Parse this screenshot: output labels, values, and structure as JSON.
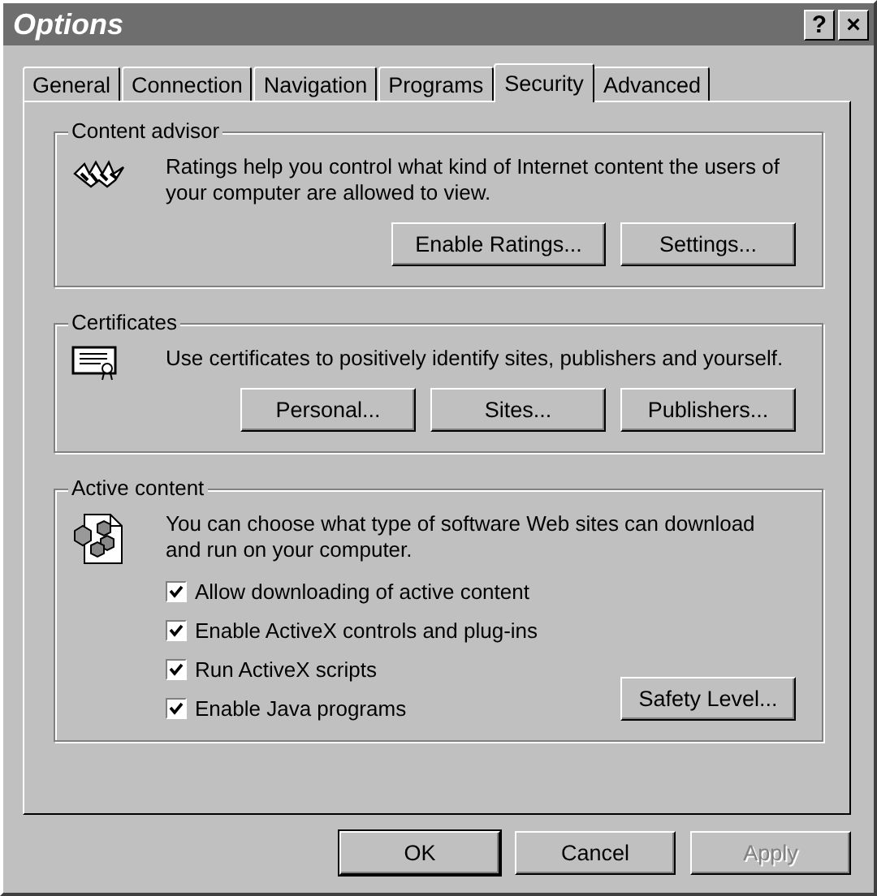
{
  "window": {
    "title": "Options",
    "title_buttons": [
      "?",
      "×"
    ]
  },
  "tabs": [
    {
      "label": "General",
      "selected": false
    },
    {
      "label": "Connection",
      "selected": false
    },
    {
      "label": "Navigation",
      "selected": false
    },
    {
      "label": "Programs",
      "selected": false
    },
    {
      "label": "Security",
      "selected": true
    },
    {
      "label": "Advanced",
      "selected": false
    }
  ],
  "groups": [
    {
      "title": "Content advisor",
      "text": "Ratings help you control what kind of Internet content the users of your computer are allowed to view.",
      "buttons": [
        "Enable Ratings...",
        "Settings..."
      ]
    },
    {
      "title": "Certificates",
      "text": "Use certificates to positively identify sites, publishers and yourself.",
      "buttons": [
        "Personal...",
        "Sites...",
        "Publishers..."
      ]
    },
    {
      "title": "Active content",
      "text": "You can choose what type of software Web sites can download and run on your computer.",
      "checkboxes": [
        {
          "label": "Allow downloading of active content",
          "checked": true
        },
        {
          "label": "Enable ActiveX controls and plug-ins",
          "checked": true
        },
        {
          "label": "Run ActiveX scripts",
          "checked": true
        },
        {
          "label": "Enable Java programs",
          "checked": true
        }
      ],
      "buttons": [
        "Safety Level..."
      ]
    }
  ],
  "footer_buttons": [
    {
      "label": "OK",
      "default": true,
      "disabled": false
    },
    {
      "label": "Cancel",
      "default": false,
      "disabled": false
    },
    {
      "label": "Apply",
      "default": false,
      "disabled": true
    }
  ]
}
